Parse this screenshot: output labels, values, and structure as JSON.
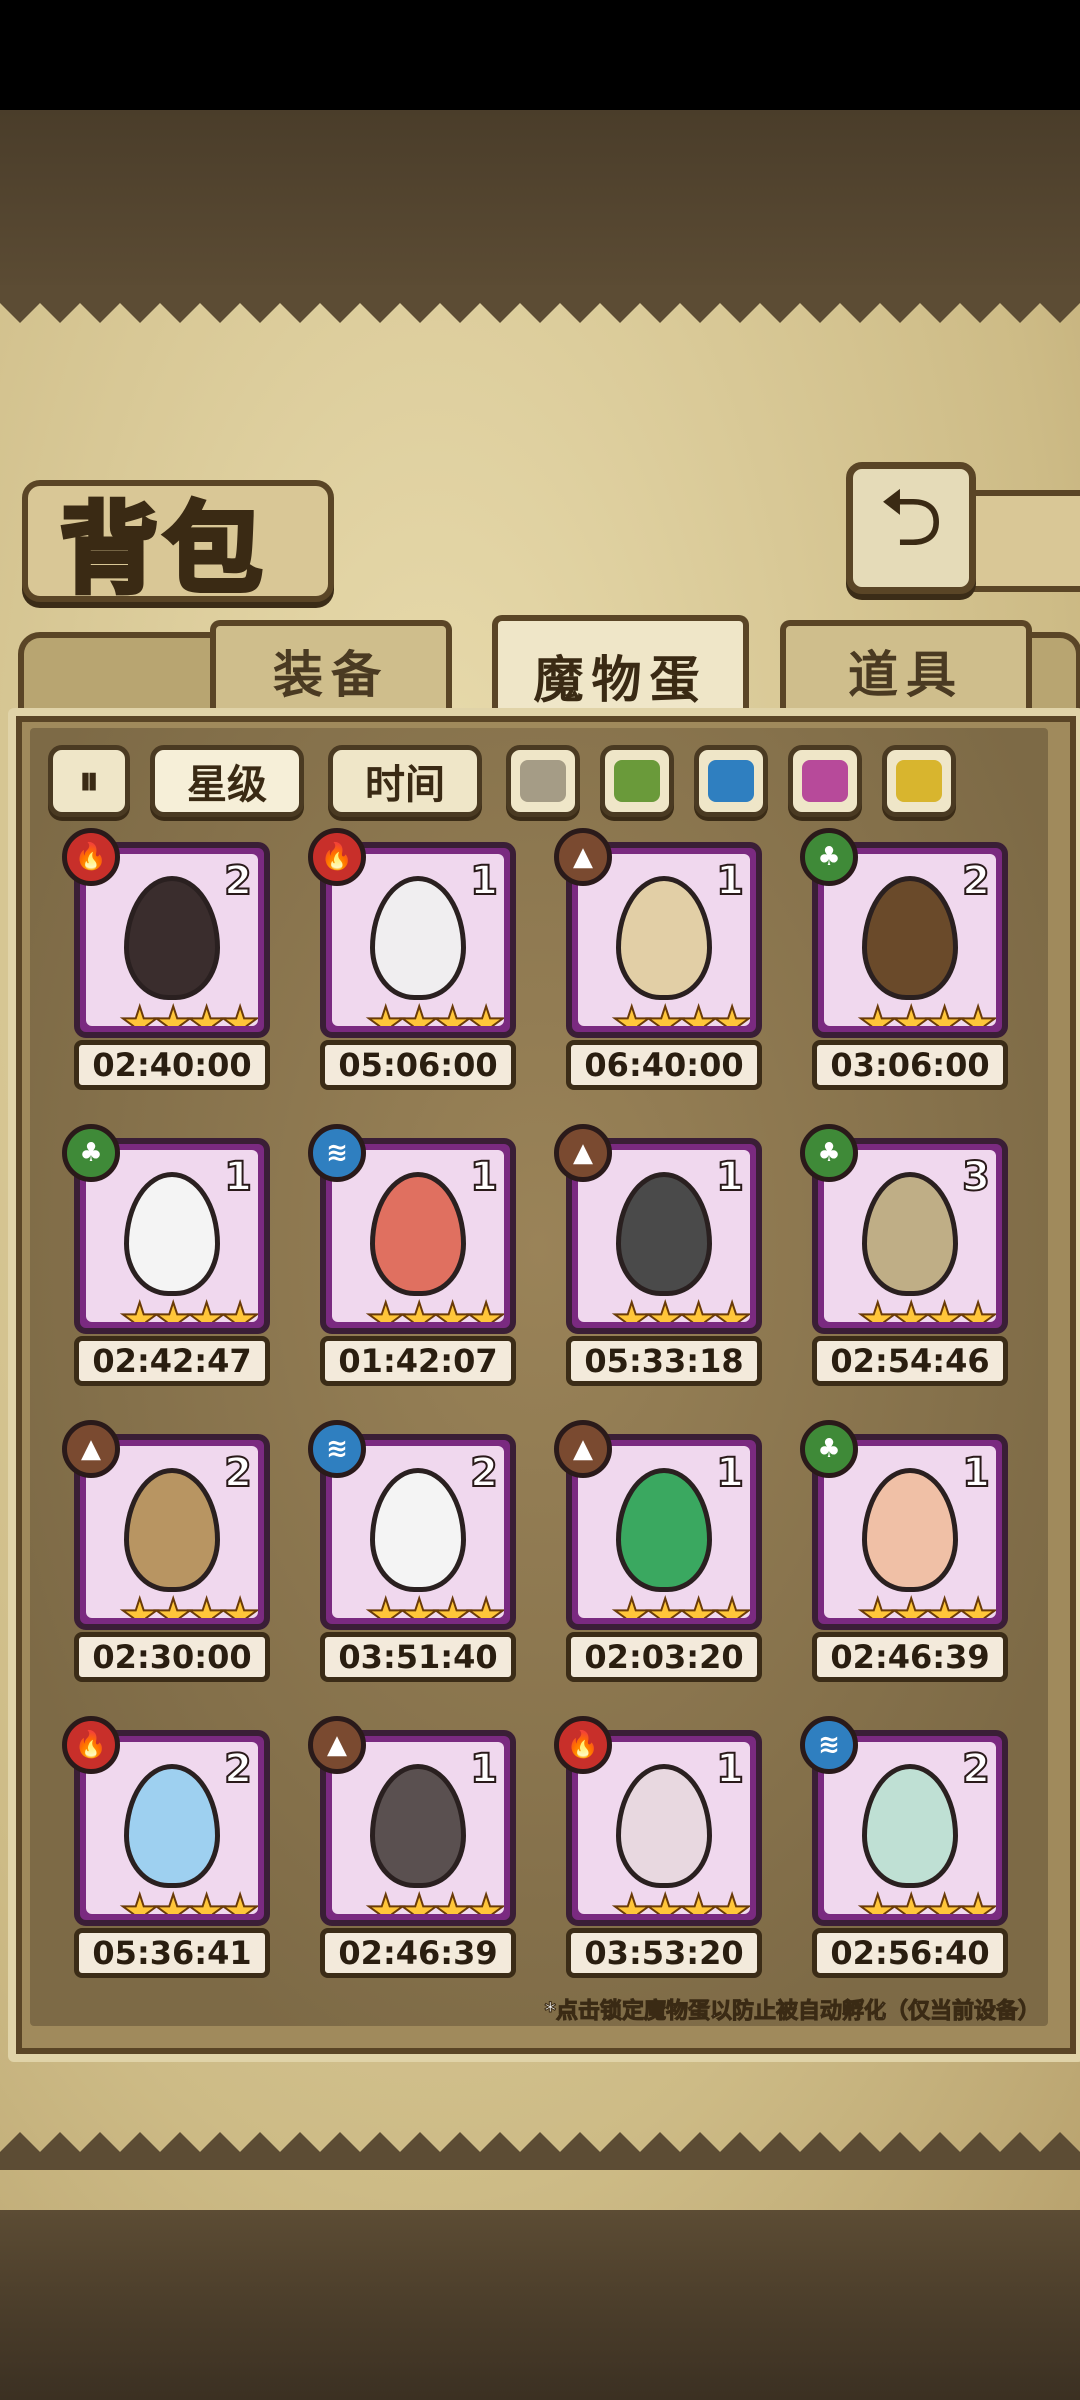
{
  "title": "背包",
  "tabs": [
    {
      "label": "装备",
      "active": false
    },
    {
      "label": "魔物蛋",
      "active": true
    },
    {
      "label": "道具",
      "active": false
    }
  ],
  "filters": {
    "toggle_icon": "pause-sort-icon",
    "sort_star": "星级",
    "sort_time": "时间",
    "colors": [
      "#a59c86",
      "#6a9a3a",
      "#2f7fc0",
      "#b74a9a",
      "#d8b52e"
    ]
  },
  "eggs": [
    {
      "element": "fire",
      "count": "2",
      "stars": "★★★★",
      "time": "02:40:00",
      "color": "#3a2d2d"
    },
    {
      "element": "fire",
      "count": "1",
      "stars": "★★★★",
      "time": "05:06:00",
      "color": "#f0eef0"
    },
    {
      "element": "earth",
      "count": "1",
      "stars": "★★★★",
      "time": "06:40:00",
      "color": "#e2cfa6"
    },
    {
      "element": "wood",
      "count": "2",
      "stars": "★★★★",
      "time": "03:06:00",
      "color": "#6a4a2a"
    },
    {
      "element": "wood",
      "count": "1",
      "stars": "★★★★",
      "time": "02:42:47",
      "color": "#f4f4f4"
    },
    {
      "element": "water",
      "count": "1",
      "stars": "★★★★",
      "time": "01:42:07",
      "color": "#e07060"
    },
    {
      "element": "earth",
      "count": "1",
      "stars": "★★★★",
      "time": "05:33:18",
      "color": "#4a4a4a"
    },
    {
      "element": "wood",
      "count": "3",
      "stars": "★★★★",
      "time": "02:54:46",
      "color": "#bfae86"
    },
    {
      "element": "earth",
      "count": "2",
      "stars": "★★★★",
      "time": "02:30:00",
      "color": "#b89562"
    },
    {
      "element": "water",
      "count": "2",
      "stars": "★★★★",
      "time": "03:51:40",
      "color": "#f4f4f4"
    },
    {
      "element": "earth",
      "count": "1",
      "stars": "★★★★",
      "time": "02:03:20",
      "color": "#3aa860"
    },
    {
      "element": "wood",
      "count": "1",
      "stars": "★★★★",
      "time": "02:46:39",
      "color": "#f0c0a6"
    },
    {
      "element": "fire",
      "count": "2",
      "stars": "★★★★",
      "time": "05:36:41",
      "color": "#9ed0f0"
    },
    {
      "element": "earth",
      "count": "1",
      "stars": "★★★★",
      "time": "02:46:39",
      "color": "#5a5050"
    },
    {
      "element": "fire",
      "count": "1",
      "stars": "★★★★",
      "time": "03:53:20",
      "color": "#e8d8e0"
    },
    {
      "element": "water",
      "count": "2",
      "stars": "★★★★",
      "time": "02:56:40",
      "color": "#bfe0d4"
    }
  ],
  "element_glyphs": {
    "fire": "🔥",
    "earth": "▲",
    "wood": "♣",
    "water": "≋"
  },
  "footer_note": "*点击锁定魔物蛋以防止被自动孵化（仅当前设备）"
}
